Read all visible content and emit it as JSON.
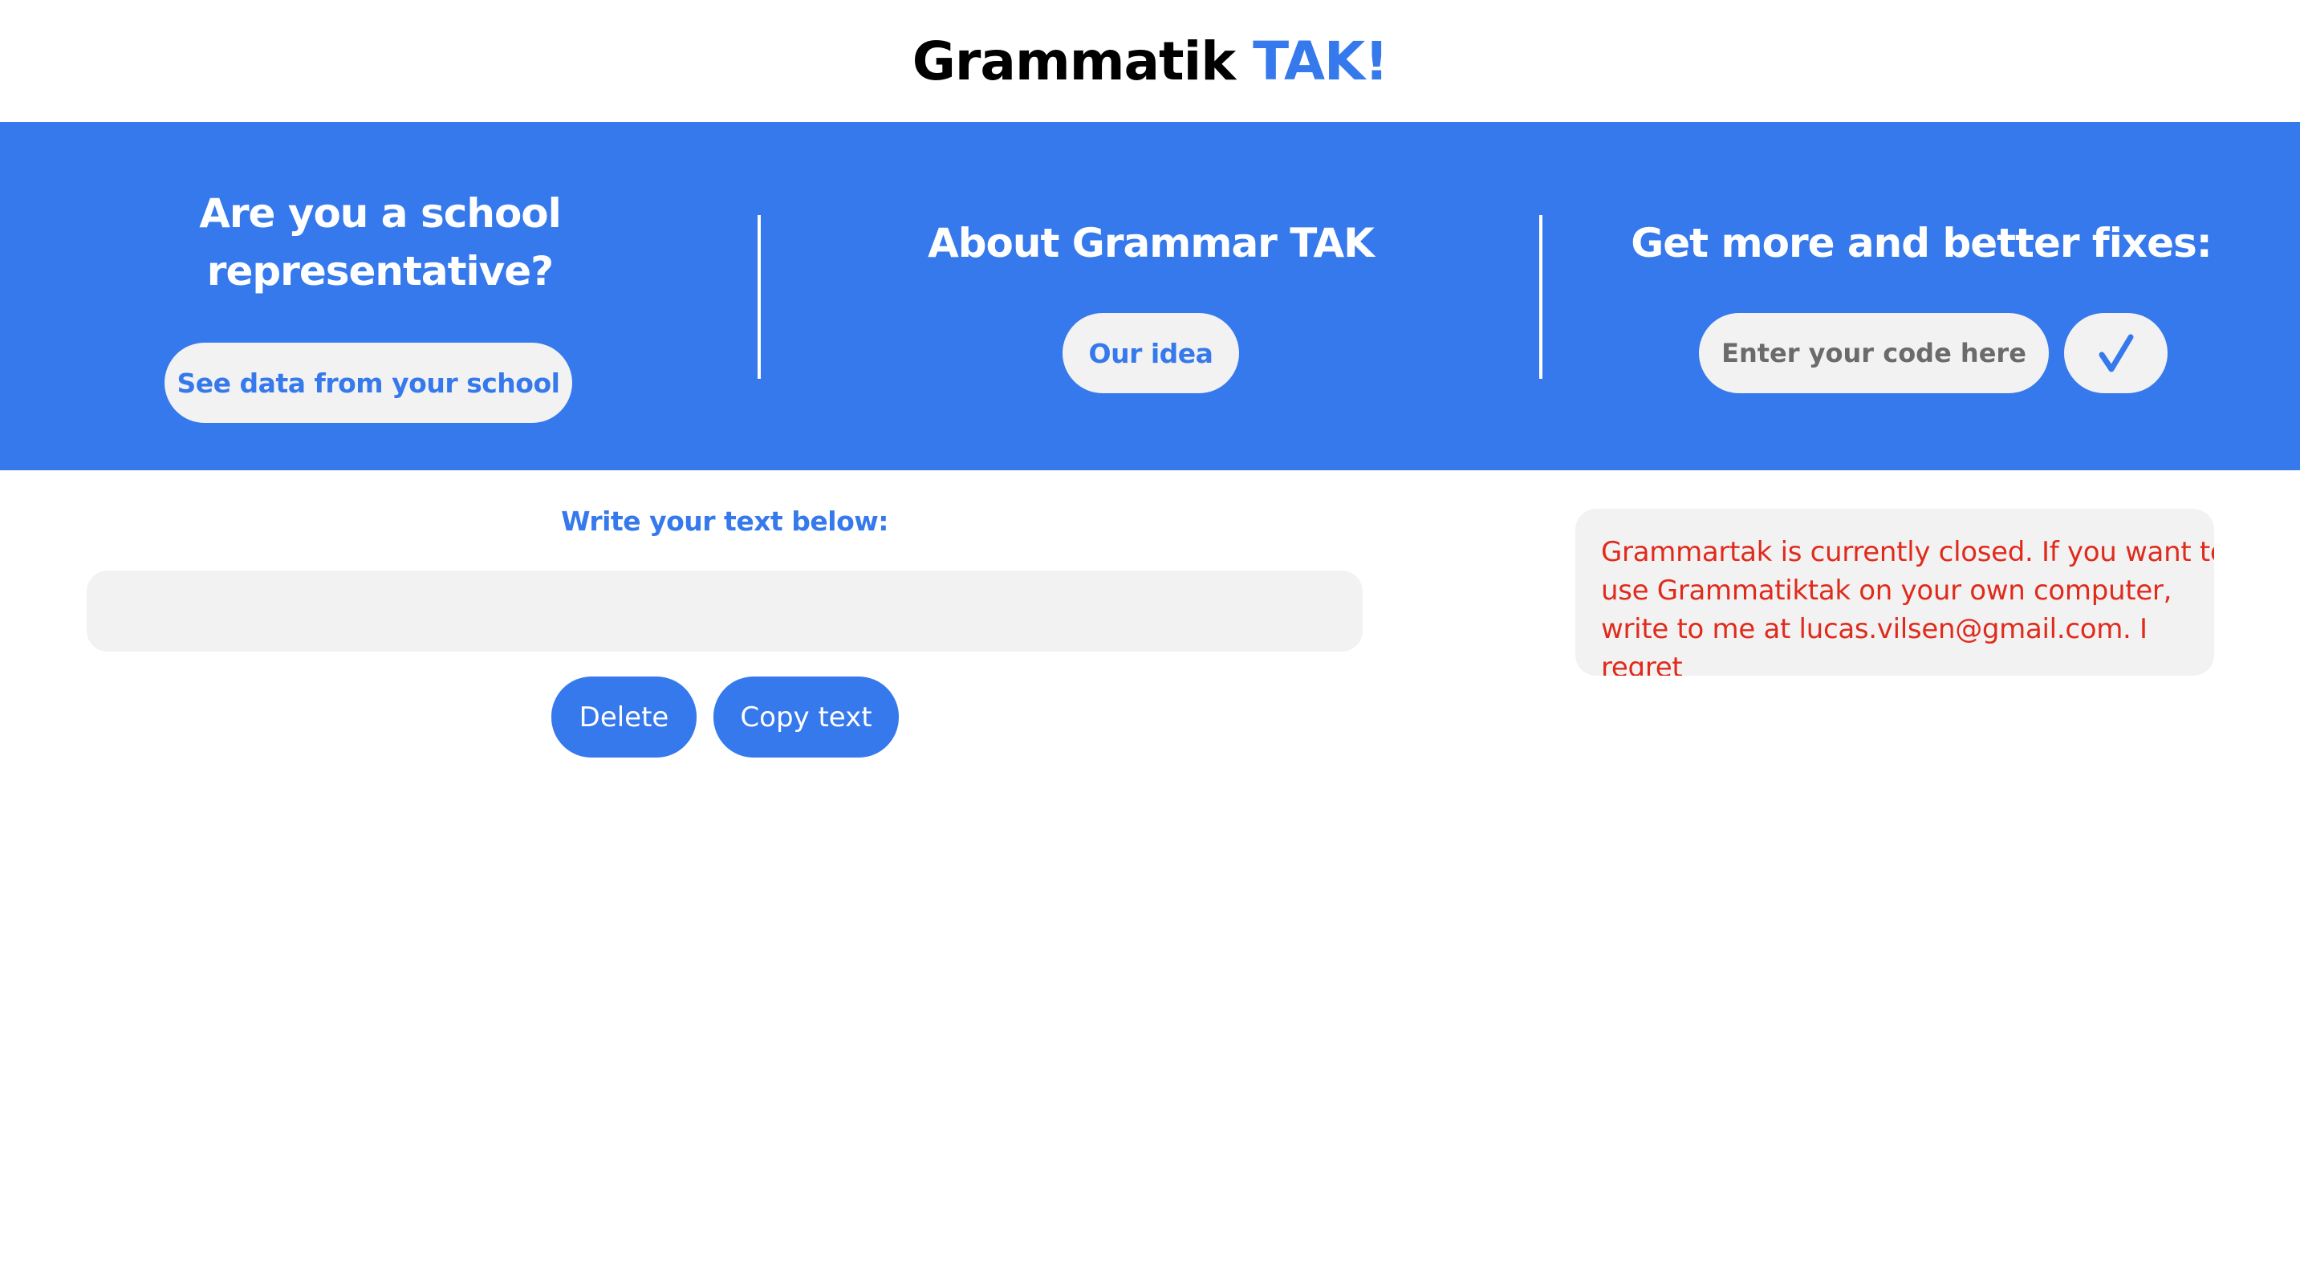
{
  "header": {
    "logo_main": "Grammatik",
    "logo_accent": "TAK!"
  },
  "banner": {
    "school": {
      "title": "Are you a school representative?",
      "button_label": "See data from your school"
    },
    "about": {
      "title": "About Grammar TAK",
      "button_label": "Our idea"
    },
    "fixes": {
      "title": "Get more and better fixes:",
      "code_placeholder": "Enter your code here",
      "code_value": "",
      "submit_icon": "checkmark-icon"
    }
  },
  "editor": {
    "label": "Write your text below:",
    "text_value": "",
    "delete_label": "Delete",
    "copy_label": "Copy text"
  },
  "notice": {
    "text": "Grammartak is currently closed. If you want to use Grammatiktak on your own computer, write to me at lucas.vilsen@gmail.com. I regret"
  },
  "colors": {
    "accent": "#3679ec",
    "light_bg": "#f2f2f2",
    "notice_text": "#e02b1c"
  }
}
